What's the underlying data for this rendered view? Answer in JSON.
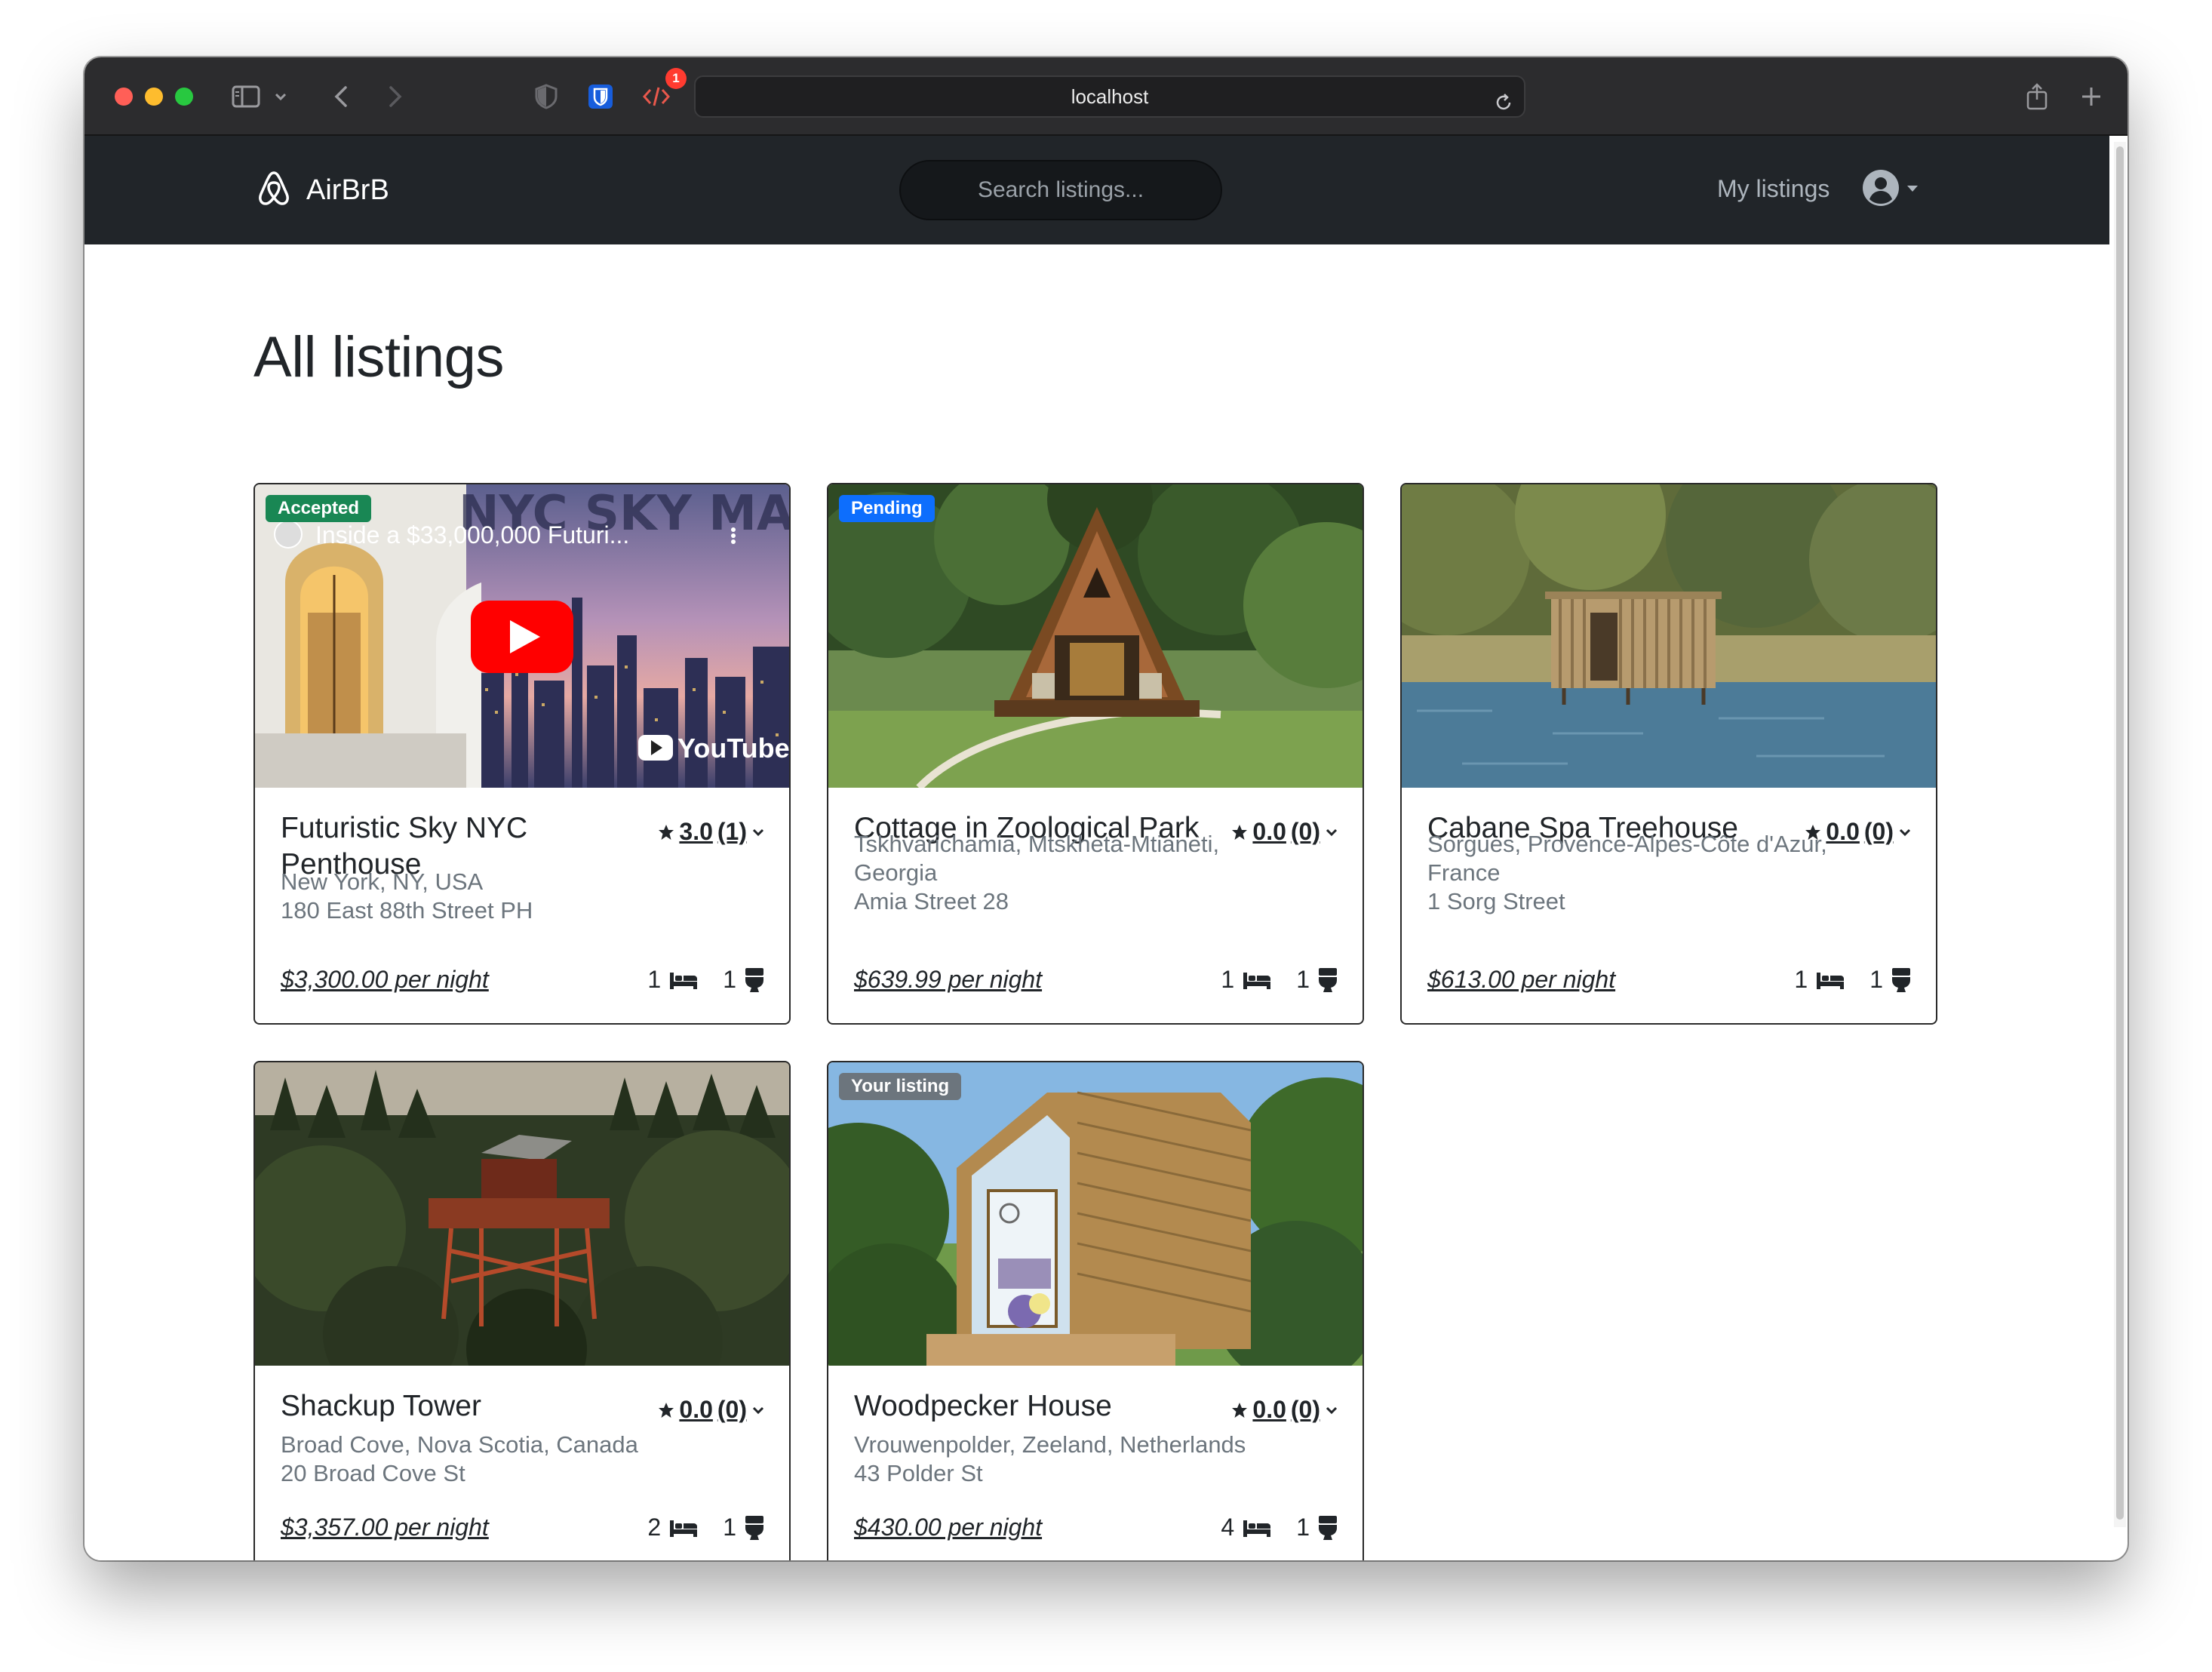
{
  "browser": {
    "url": "localhost",
    "devtools_badge": "1"
  },
  "app": {
    "brand": "AirBrB",
    "search_placeholder": "Search listings...",
    "my_listings": "My listings",
    "page_title": "All listings"
  },
  "listings": [
    {
      "title": "Futuristic Sky NYC Penthouse",
      "rating": "3.0",
      "reviews": "(1)",
      "location": "New York, NY, USA",
      "location2": "",
      "street": "180 East 88th Street PH",
      "price": "$3,300.00 per night",
      "beds": "1",
      "baths": "1",
      "badge": "Accepted",
      "video_title": "Inside a $33,000,000 Futuri...",
      "video_overlay": "NYC SKY MANSION",
      "video_brand": "YouTube"
    },
    {
      "title": "Cottage in Zoological Park",
      "rating": "0.0",
      "reviews": "(0)",
      "location": "Tskhvarichamia, Mtskheta-Mtianeti,",
      "location2": "Georgia",
      "street": "Amia Street 28",
      "price": "$639.99 per night",
      "beds": "1",
      "baths": "1",
      "badge": "Pending"
    },
    {
      "title": "Cabane Spa Treehouse",
      "rating": "0.0",
      "reviews": "(0)",
      "location": "Sorgues, Provence-Alpes-Côte d'Azur,",
      "location2": "France",
      "street": "1 Sorg Street",
      "price": "$613.00 per night",
      "beds": "1",
      "baths": "1"
    },
    {
      "title": "Shackup Tower",
      "rating": "0.0",
      "reviews": "(0)",
      "location": "Broad Cove, Nova Scotia, Canada",
      "location2": "",
      "street": "20 Broad Cove St",
      "price": "$3,357.00 per night",
      "beds": "2",
      "baths": "1"
    },
    {
      "title": "Woodpecker House",
      "rating": "0.0",
      "reviews": "(0)",
      "location": "Vrouwenpolder, Zeeland, Netherlands",
      "location2": "",
      "street": "43 Polder St",
      "price": "$430.00 per night",
      "beds": "4",
      "baths": "1",
      "badge": "Your listing"
    }
  ],
  "icons": {
    "star": "star-icon",
    "chevron": "chevron-down-icon",
    "bed": "bed-icon",
    "toilet": "toilet-icon",
    "brand": "airbnb-logo-icon",
    "account": "user-circle-icon"
  }
}
